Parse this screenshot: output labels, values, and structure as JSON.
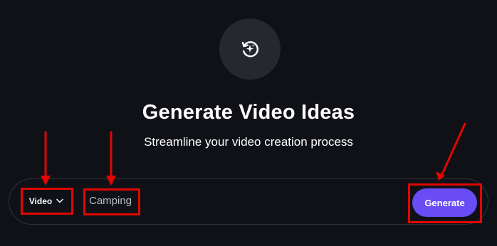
{
  "header": {
    "icon": "sparkle-refresh-icon",
    "title": "Generate Video Ideas",
    "subtitle": "Streamline your video creation process"
  },
  "form": {
    "type_select": {
      "selected": "Video",
      "icon": "chevron-down-icon"
    },
    "topic_input": {
      "value": "Camping"
    },
    "generate_label": "Generate"
  },
  "colors": {
    "background": "#0f1117",
    "icon_circle": "#262830",
    "accent": "#6a4cf5",
    "annotation": "#e10600"
  },
  "annotations": {
    "count": 3,
    "targets": [
      "type-select",
      "topic-input",
      "generate-button"
    ]
  }
}
